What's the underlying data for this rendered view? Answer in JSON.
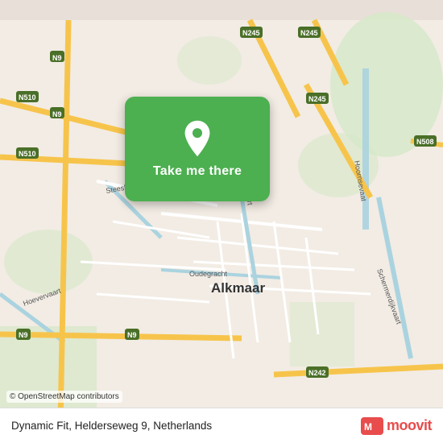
{
  "map": {
    "city": "Alkmaar",
    "background_color": "#e8e0d8",
    "road_color": "#f9d77e",
    "road_color_light": "#ffffff",
    "road_color_main": "#f7c44b",
    "water_color": "#aad3df",
    "green_color": "#c8dfc8"
  },
  "button": {
    "label": "Take me there",
    "background": "#4caf50"
  },
  "bottom_bar": {
    "location": "Dynamic Fit, Helderseweg 9, Netherlands",
    "logo": "moovit"
  },
  "attribution": "© OpenStreetMap contributors"
}
